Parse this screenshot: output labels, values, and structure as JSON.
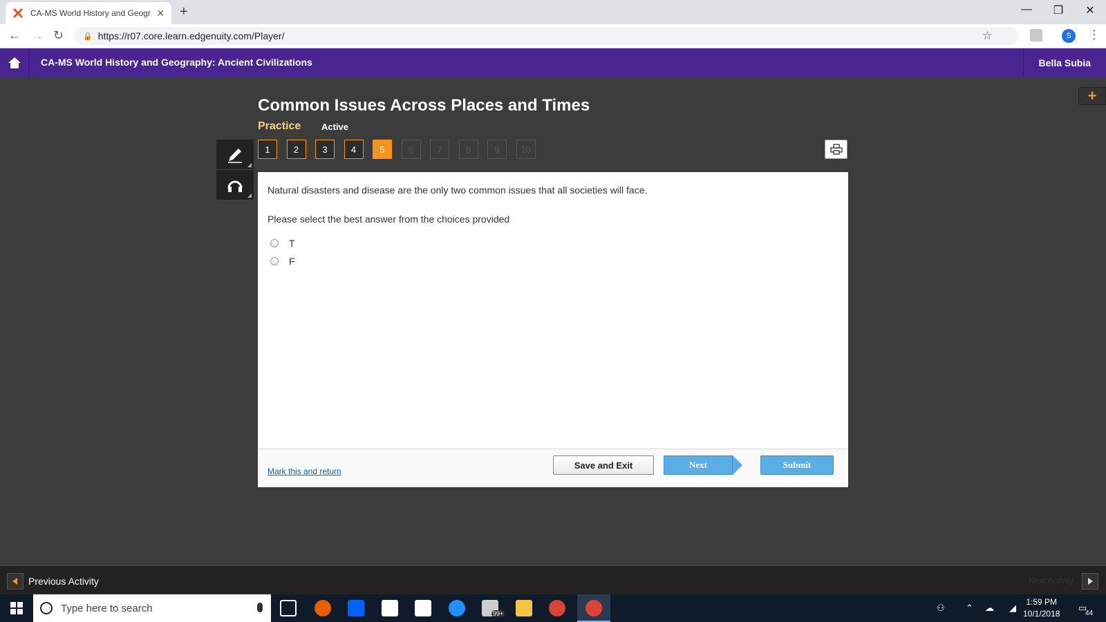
{
  "browser": {
    "tab_title": "CA-MS World History and Geogr",
    "url": "https://r07.core.learn.edgenuity.com/Player/",
    "avatar_letter": "S"
  },
  "app": {
    "course_title": "CA-MS World History and Geography: Ancient Civilizations",
    "user_name": "Bella Subia",
    "accent_color": "#4a2592"
  },
  "lesson": {
    "title": "Common Issues Across Places and Times",
    "mode": "Practice",
    "status": "Active",
    "questions": [
      "1",
      "2",
      "3",
      "4",
      "5",
      "6",
      "7",
      "8",
      "9",
      "10"
    ],
    "current_question": 5
  },
  "question": {
    "prompt": "Natural disasters and disease are the only two common issues that all societies will face.",
    "instruction": "Please select the best answer from the choices provided",
    "choices": [
      "T",
      "F"
    ],
    "mark_link": "Mark this and return",
    "save_exit_label": "Save and Exit",
    "next_label": "Next",
    "submit_label": "Submit"
  },
  "activity_nav": {
    "previous_label": "Previous Activity",
    "next_label": "Next Activity"
  },
  "taskbar": {
    "search_placeholder": "Type here to search",
    "mail_badge": "99+",
    "time": "1:59 PM",
    "date": "10/1/2018",
    "notification_count": "44"
  }
}
